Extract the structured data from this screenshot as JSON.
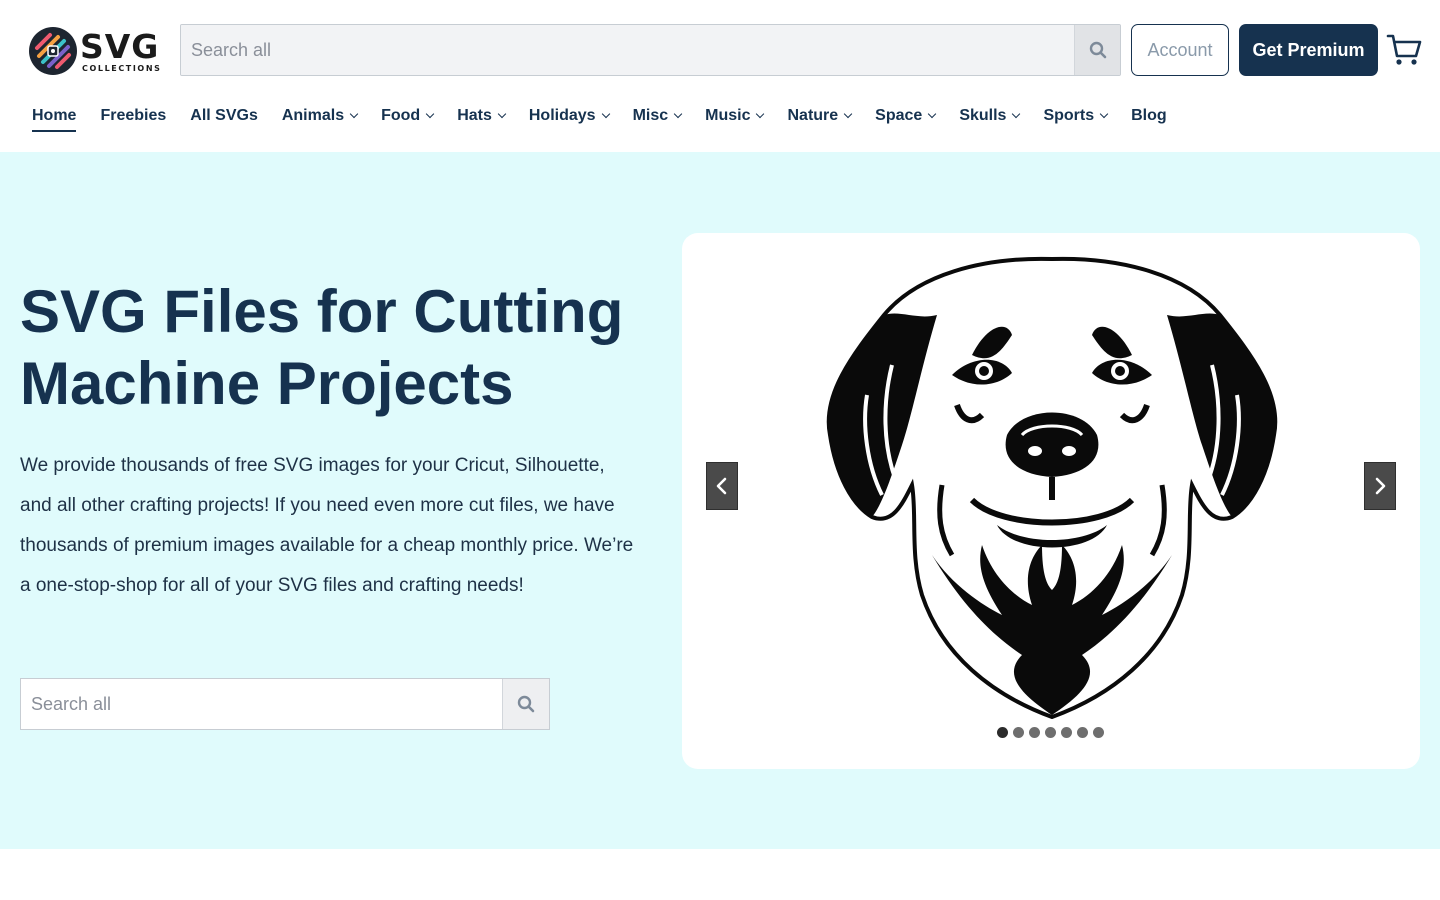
{
  "brand": {
    "name": "SVG",
    "tagline": "COLLECTIONS"
  },
  "header": {
    "search_placeholder": "Search all",
    "account_label": "Account",
    "premium_label": "Get Premium",
    "cart_icon": "cart-icon"
  },
  "nav": {
    "items": [
      {
        "label": "Home",
        "active": true,
        "dropdown": false
      },
      {
        "label": "Freebies",
        "dropdown": false
      },
      {
        "label": "All SVGs",
        "dropdown": false
      },
      {
        "label": "Animals",
        "dropdown": true
      },
      {
        "label": "Food",
        "dropdown": true
      },
      {
        "label": "Hats",
        "dropdown": true
      },
      {
        "label": "Holidays",
        "dropdown": true
      },
      {
        "label": "Misc",
        "dropdown": true
      },
      {
        "label": "Music",
        "dropdown": true
      },
      {
        "label": "Nature",
        "dropdown": true
      },
      {
        "label": "Space",
        "dropdown": true
      },
      {
        "label": "Skulls",
        "dropdown": true
      },
      {
        "label": "Sports",
        "dropdown": true
      },
      {
        "label": "Blog",
        "dropdown": false
      }
    ]
  },
  "hero": {
    "title_line1": "SVG Files for Cutting",
    "title_line2": "Machine Projects",
    "body": "We provide thousands of free SVG images for your Cricut, Silhouette, and all other crafting projects! If you need even more cut files, we have thousands of premium images available for a cheap monthly price. We’re a one-stop-shop for all of your SVG files and crafting needs!",
    "search_placeholder": "Search all"
  },
  "slider": {
    "slide_count": 7,
    "active_slide": 1,
    "image": "golden-retriever-head-svg"
  },
  "colors": {
    "navy": "#16324f",
    "hero_bg": "#e0fbfc",
    "white": "#ffffff"
  }
}
